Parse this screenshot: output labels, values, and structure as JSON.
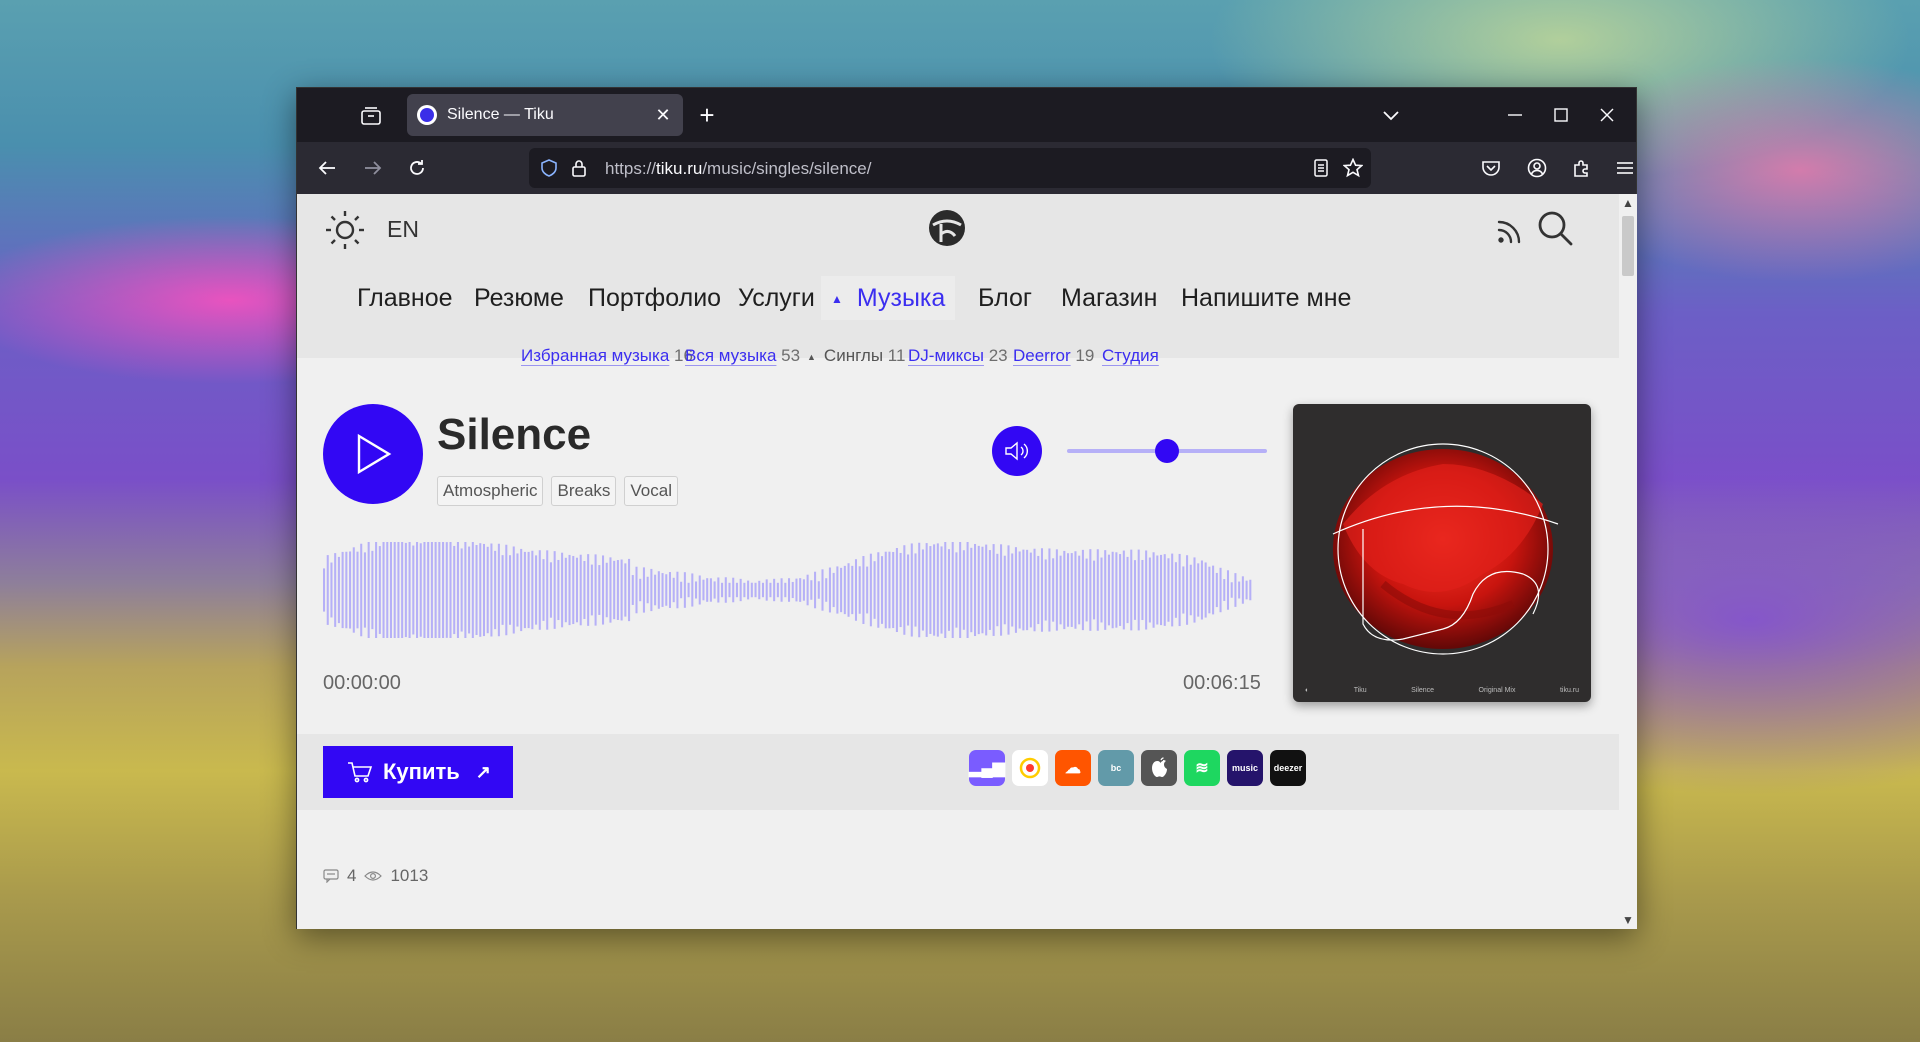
{
  "browser": {
    "tab_title": "Silence — Tiku",
    "url_prefix": "https://",
    "url_host": "tiku.ru",
    "url_path": "/music/singles/silence/"
  },
  "header": {
    "lang": "EN"
  },
  "nav": {
    "items": [
      {
        "label": "Главное"
      },
      {
        "label": "Резюме"
      },
      {
        "label": "Портфолио"
      },
      {
        "label": "Услуги"
      },
      {
        "label": "Музыка",
        "active": true
      },
      {
        "label": "Блог"
      },
      {
        "label": "Магазин"
      },
      {
        "label": "Напишите мне"
      }
    ]
  },
  "subnav": {
    "items": [
      {
        "label": "Избранная музыка",
        "count": "16"
      },
      {
        "label": "Вся музыка",
        "count": "53"
      },
      {
        "label": "Синглы",
        "count": "11",
        "current": true
      },
      {
        "label": "DJ-миксы",
        "count": "23"
      },
      {
        "label": "Deerror",
        "count": "19"
      },
      {
        "label": "Студия",
        "count": ""
      }
    ]
  },
  "track": {
    "title": "Silence",
    "tags": [
      "Atmospheric",
      "Breaks",
      "Vocal"
    ],
    "time_current": "00:00:00",
    "time_total": "00:06:15",
    "volume": 0.5
  },
  "cover": {
    "artist": "Tiku",
    "title": "Silence",
    "mix": "Original Mix",
    "site": "tiku.ru"
  },
  "buy": {
    "label": "Купить",
    "arrow": "↗"
  },
  "stores": [
    {
      "name": "vk-music-icon",
      "color": "#7a5cff"
    },
    {
      "name": "yandex-music-icon",
      "color": "#ffffff"
    },
    {
      "name": "soundcloud-icon",
      "color": "#ff5500"
    },
    {
      "name": "bandcamp-icon",
      "color": "#629aa9",
      "text": "bc"
    },
    {
      "name": "apple-music-icon",
      "color": "#555555"
    },
    {
      "name": "spotify-icon",
      "color": "#1ed760"
    },
    {
      "name": "amazon-music-icon",
      "color": "#25146b",
      "text": "music"
    },
    {
      "name": "deezer-icon",
      "color": "#111111",
      "text": "deezer"
    }
  ],
  "meta": {
    "comments": "4",
    "views": "1013"
  },
  "colors": {
    "accent": "#3207f4",
    "waveform": "#b6b0f7"
  }
}
